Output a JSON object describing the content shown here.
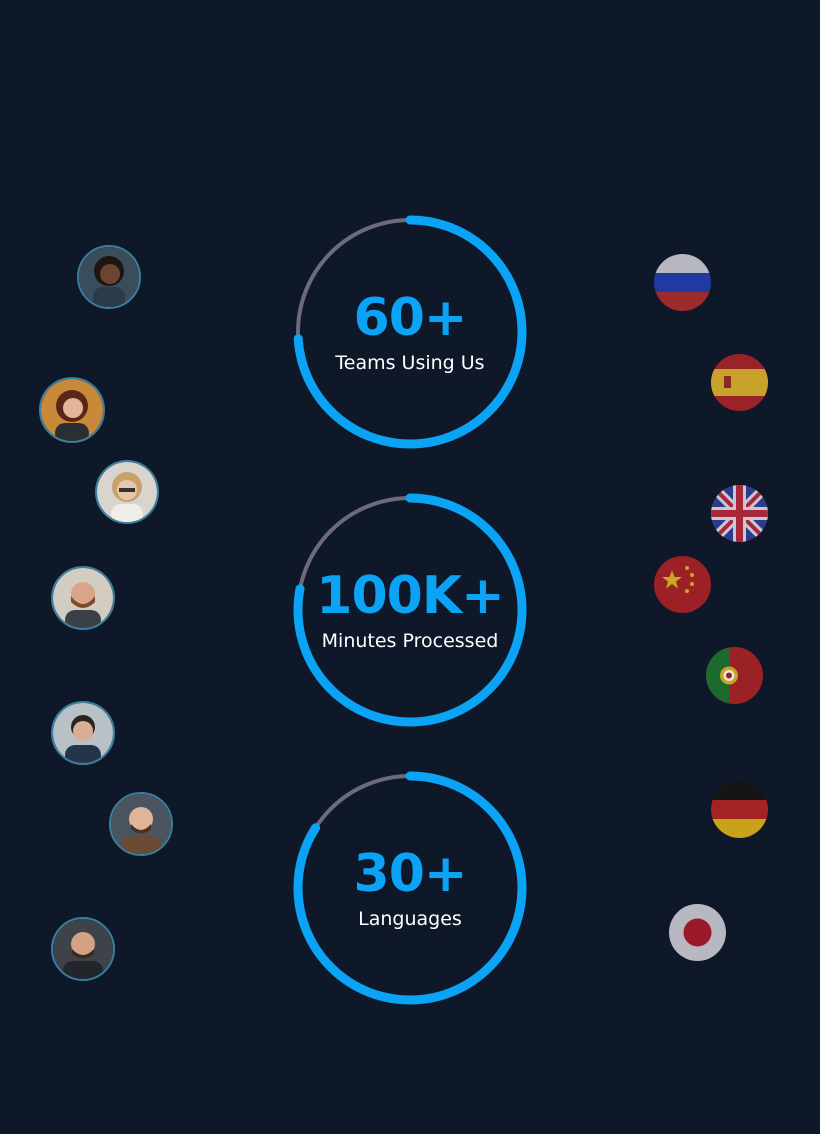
{
  "stats": [
    {
      "value": "60+",
      "label": "Teams Using Us",
      "progress": 0.74
    },
    {
      "value": "100K+",
      "label": "Minutes Processed",
      "progress": 0.78
    },
    {
      "value": "30+",
      "label": "Languages",
      "progress": 0.84
    }
  ],
  "colors": {
    "background": "#0f1828",
    "accent": "#0aa3f5",
    "track": "#6d6a7e"
  },
  "avatars": [
    "avatar-woman-headset",
    "avatar-woman-red-hair",
    "avatar-woman-glasses",
    "avatar-man-beard",
    "avatar-man-office",
    "avatar-man-bald",
    "avatar-man-suit"
  ],
  "flags": [
    "russia-flag",
    "spain-flag",
    "uk-flag",
    "china-flag",
    "portugal-flag",
    "germany-flag",
    "japan-flag"
  ]
}
